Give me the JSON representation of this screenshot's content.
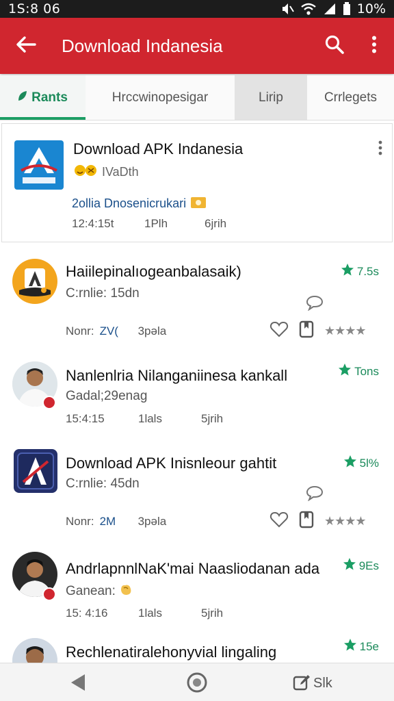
{
  "status_bar": {
    "time": "1S:8 06",
    "battery": "10%"
  },
  "toolbar": {
    "title": "Download Indanesia",
    "icons": [
      "back-arrow-icon",
      "search-icon",
      "overflow-menu-icon"
    ]
  },
  "tabs": [
    {
      "label": "Rants",
      "selected": true
    },
    {
      "label": "Hrccwinopesigar",
      "selected": false
    },
    {
      "label": "Lirip",
      "selected": false
    },
    {
      "label": "Crrlegets",
      "selected": false
    }
  ],
  "featured": {
    "title": "Download APK Indanesia",
    "subtitle": "IVaDth",
    "link_text": "2ollia Dnosenicrukari",
    "meta": [
      "12:4:15t",
      "1Plh",
      "6jrih"
    ]
  },
  "items": [
    {
      "title": "Haiilepinalıogeanbalasaik)",
      "subtitle": "C:rnlie: 15dn",
      "rating": "7.5s",
      "meta_prefix": "Nonr:",
      "meta_highlight": "ZV(",
      "meta_extra": "3pəla"
    },
    {
      "title": "Nanlenlria Nilanganiinesa kankall",
      "subtitle": "Gadal;29enag",
      "rating": "Tons",
      "meta": [
        "15:4:15",
        "1lals",
        "5jrih"
      ]
    },
    {
      "title": "Download APK Inisnleour gahtit",
      "subtitle": "C:rnlie: 45dn",
      "rating": "5l%",
      "meta_prefix": "Nonr:",
      "meta_highlight": "2M",
      "meta_extra": "3pəla"
    },
    {
      "title": "AndrlapnnlNaK'mai Naasliodanan ada",
      "subtitle": "Ganean:",
      "rating": "9Es",
      "meta": [
        "15: 4:16",
        "1lals",
        "5jrih"
      ]
    },
    {
      "title": "Rechlenatiralehonyvial lingaling",
      "rating": "15e"
    }
  ],
  "navbar": {
    "recent_label": "Slk"
  },
  "colors": {
    "toolbar": "#d0262f",
    "accent_green": "#1b9e64",
    "link_blue": "#1a4f8a"
  }
}
